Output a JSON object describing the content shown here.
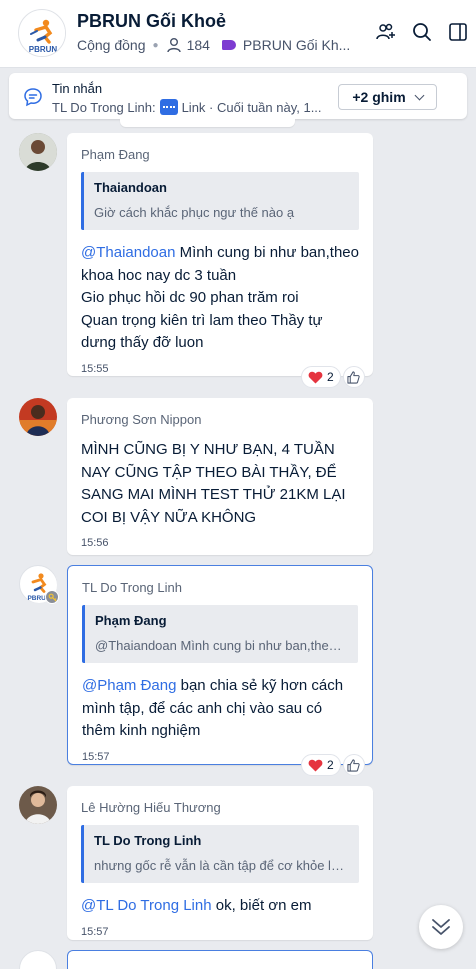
{
  "header": {
    "group_name": "PBRUN Gối Khoẻ",
    "community_label": "Cộng đồng",
    "member_count": "184",
    "tag_label": "PBRUN Gối Kh...",
    "avatar_text": "PBRUN"
  },
  "pinned": {
    "title": "Tin nhắn",
    "sender": "TL Do Trong Linh:",
    "preview_suffix": "Link · Cuối tuần này, 1...",
    "more_pins_label": "+2 ghim"
  },
  "messages": [
    {
      "sender": "Phạm Đang",
      "quote_name": "Thaiandoan",
      "quote_text": "Giờ cách khắc phục ngư thế nào ạ",
      "mention": "@Thaiandoan",
      "text": " Mình cung bi như ban,theo khoa hoc nay dc 3 tuần\nGio phục hồi dc 90 phan trăm roi\nQuan trọng kiên trì lam theo Thầy tự dưng thấy đỡ luon",
      "time": "15:55",
      "reaction_count": "2"
    },
    {
      "sender": "Phương Sơn Nippon",
      "text": "MÌNH CŨNG BỊ Y NHƯ BẠN, 4 TUẦN NAY CŨNG TẬP THEO BÀI THẦY, ĐỂ SANG MAI MÌNH TEST THỬ 21KM LẠI COI BỊ VẬY NỮA KHÔNG",
      "time": "15:56"
    },
    {
      "sender": "TL Do Trong Linh",
      "quote_name": "Phạm Đang",
      "quote_text": "@Thaiandoan Mình cung bi như ban,theo k...",
      "mention": "@Phạm Đang",
      "text": " bạn chia sẻ kỹ hơn cách mình tập, để các anh chị vào sau có thêm kinh nghiệm",
      "time": "15:57",
      "reaction_count": "2"
    },
    {
      "sender": "Lê Hường Hiếu Thương",
      "quote_name": "TL Do Trong Linh",
      "quote_text": "nhưng gốc rễ vẫn là cần tập để cơ khỏe lên...",
      "mention": "@TL Do Trong Linh",
      "text": " ok, biết ơn em",
      "time": "15:57"
    }
  ],
  "colors": {
    "accent": "#2f6de3",
    "background": "#e9ebef",
    "heart": "#e5343f"
  }
}
